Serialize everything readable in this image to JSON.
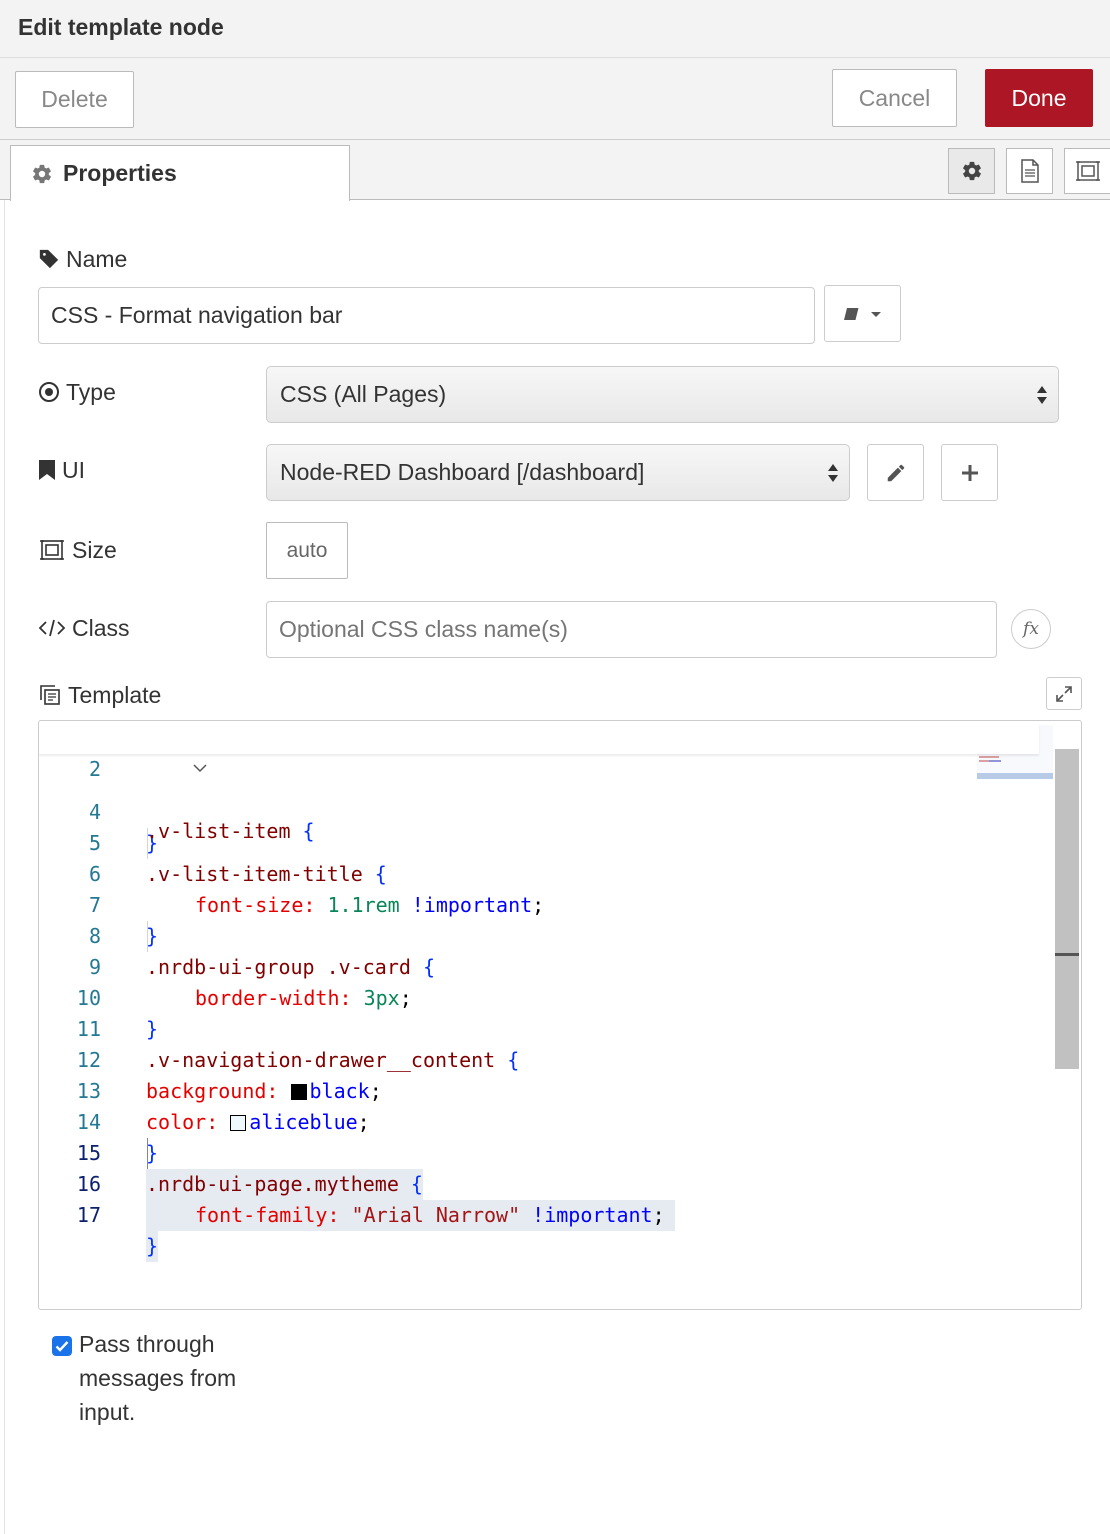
{
  "header": {
    "title": "Edit template node"
  },
  "toolbar": {
    "delete_label": "Delete",
    "cancel_label": "Cancel",
    "done_label": "Done"
  },
  "tabs": {
    "properties_label": "Properties"
  },
  "form": {
    "name_label": "Name",
    "name_value": "CSS - Format navigation bar",
    "type_label": "Type",
    "type_value": "CSS (All Pages)",
    "ui_label": "UI",
    "ui_value": "Node-RED Dashboard [/dashboard]",
    "size_label": "Size",
    "size_value": "auto",
    "class_label": "Class",
    "class_placeholder": "Optional CSS class name(s)",
    "template_label": "Template"
  },
  "editor": {
    "lines": [
      {
        "num": "2",
        "selector": ".v-list-item",
        "brace": " {"
      },
      {
        "num": "4",
        "text": "}"
      },
      {
        "num": "5",
        "selector": ".v-list-item-title",
        "brace": " {"
      },
      {
        "num": "6",
        "prop": "font-size:",
        "value": " 1.1rem",
        "kw": " !important",
        "end": ";"
      },
      {
        "num": "7",
        "text": "}"
      },
      {
        "num": "8",
        "selector": ".nrdb-ui-group .v-card",
        "brace": " {"
      },
      {
        "num": "9",
        "prop": "border-width:",
        "value": " 3px",
        "end": ";"
      },
      {
        "num": "10",
        "text": "}"
      },
      {
        "num": "11",
        "selector": ".v-navigation-drawer__content",
        "brace": " {"
      },
      {
        "num": "12",
        "prop": "background:",
        "kwval": "black",
        "end": ";"
      },
      {
        "num": "13",
        "prop": "color:",
        "kwval": "aliceblue",
        "end": ";"
      },
      {
        "num": "14",
        "text": "}"
      },
      {
        "num": "15",
        "selector": ".nrdb-ui-page.mytheme",
        "brace": " {"
      },
      {
        "num": "16",
        "prop": "font-family:",
        "str": " \"Arial Narrow\"",
        "kw": " !important",
        "end": ";"
      },
      {
        "num": "17",
        "text": "}"
      }
    ],
    "swatch_black": "#000000",
    "swatch_aliceblue": "#f0f8ff"
  },
  "pass_through": {
    "label": "Pass through messages from input.",
    "checked": true
  },
  "colors": {
    "done": "#ad1625",
    "checkbox": "#1a73e8"
  }
}
